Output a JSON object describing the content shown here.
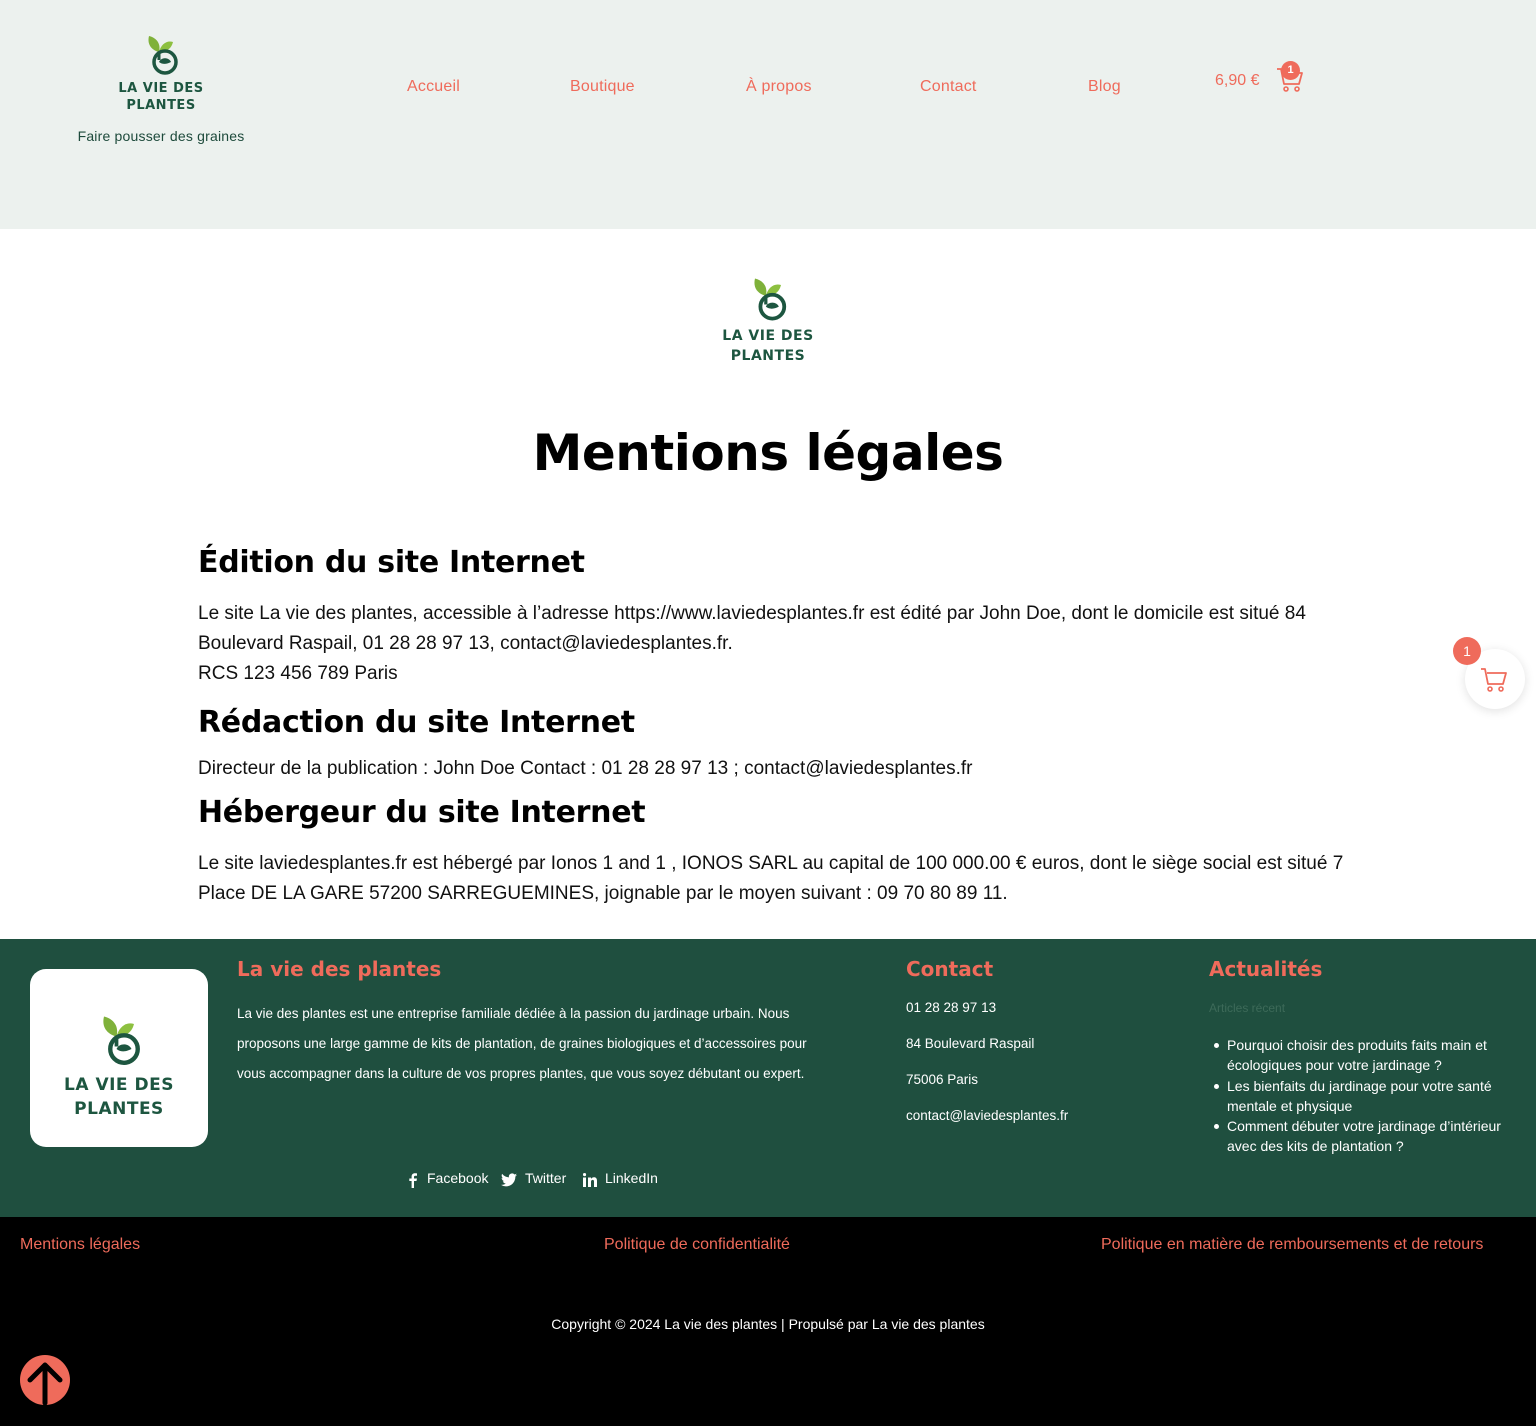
{
  "colors": {
    "accent": "#ef6b5b",
    "brand_green": "#1d5640",
    "footer_green": "#1f4f3f",
    "header_bg": "#ecf1ee"
  },
  "header": {
    "logo_line1": "LA VIE DES",
    "logo_line2": "PLANTES",
    "tagline": "Faire pousser des graines",
    "nav": [
      "Accueil",
      "Boutique",
      "À propos",
      "Contact",
      "Blog"
    ],
    "cart_amount": "6,90 €",
    "cart_count": "1",
    "cart_icon": "cart-icon"
  },
  "main": {
    "logo_line1": "LA VIE DES",
    "logo_line2": "PLANTES",
    "title": "Mentions légales",
    "sections": [
      {
        "heading": "Édition du site Internet",
        "lines": [
          "Le site La vie des plantes, accessible à l’adresse https://www.laviedesplantes.fr est édité par John Doe, dont le domicile est situé 84 Boulevard Raspail, 01 28 28 97 13, contact@laviedesplantes.fr.",
          "RCS 123 456 789  Paris"
        ]
      },
      {
        "heading": "Rédaction du site Internet",
        "lines": [
          "Directeur de la publication : John Doe Contact : 01 28 28 97 13 ; contact@laviedesplantes.fr"
        ]
      },
      {
        "heading": "Hébergeur du site Internet",
        "lines": [
          "Le site laviedesplantes.fr est hébergé par Ionos 1 and 1 , IONOS SARL au capital de 100 000.00 € euros, dont le siège social est situé 7 Place DE LA GARE 57200 SARREGUEMINES, joignable par le moyen suivant : 09 70 80 89 11."
        ]
      }
    ]
  },
  "floating_cart": {
    "count": "1",
    "icon": "cart-icon"
  },
  "footer": {
    "logo_line1": "LA VIE DES",
    "logo_line2": "PLANTES",
    "about_title": "La vie des plantes",
    "about_text": "La vie des plantes est une entreprise familiale dédiée à la passion du jardinage urbain. Nous proposons une large gamme de kits de plantation, de graines biologiques et d’accessoires pour vous accompagner dans la culture de vos propres plantes, que vous soyez débutant ou expert.",
    "social": [
      {
        "label": "Facebook",
        "icon": "facebook-icon"
      },
      {
        "label": "Twitter",
        "icon": "twitter-icon"
      },
      {
        "label": "LinkedIn",
        "icon": "linkedin-icon"
      }
    ],
    "contact_title": "Contact",
    "contact": [
      "01 28 28 97 13",
      "84 Boulevard Raspail",
      "75006  Paris",
      "contact@laviedesplantes.fr"
    ],
    "news_title": "Actualités",
    "news_label": "Articles récent",
    "news": [
      "Pourquoi choisir des produits faits main et écologiques pour votre jardinage ?",
      "Les bienfaits du jardinage pour votre santé mentale et physique",
      "Comment débuter votre jardinage d’intérieur avec des kits de plantation ?"
    ]
  },
  "bottom": {
    "links": [
      "Mentions légales",
      "Politique de confidentialité",
      "Politique en matière de remboursements et de retours"
    ],
    "copyright": "Copyright © 2024 La vie des plantes | Propulsé par La vie des plantes",
    "to_top_icon": "arrow-up-icon"
  }
}
